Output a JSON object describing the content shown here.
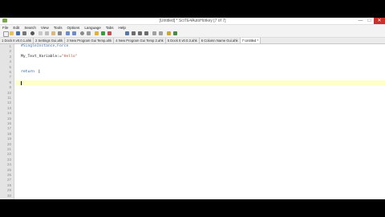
{
  "window": {
    "title": "[Untitled] * SciTE4AutoHotkey [7 of 7]",
    "controls": [
      "—",
      "□",
      "✕"
    ]
  },
  "menu": [
    "File",
    "Edit",
    "Search",
    "View",
    "Tools",
    "Options",
    "Language",
    "Tabs",
    "Help"
  ],
  "tabs": [
    {
      "label": "1 Dock It v0.0.1.ahk",
      "active": false
    },
    {
      "label": "2 Settings Gui.ahk",
      "active": false
    },
    {
      "label": "3 New Program Gui Temp.ahk",
      "active": false
    },
    {
      "label": "4 New Program Gui Temp 2.ahk",
      "active": false
    },
    {
      "label": "5 Dock It v0.0.3.ahk",
      "active": false
    },
    {
      "label": "6 Column Name Gui.ahk",
      "active": false
    },
    {
      "label": "7 Untitled *",
      "active": true
    }
  ],
  "editor": {
    "line_numbers": [
      "1",
      "2",
      "3",
      "4",
      "5",
      "6",
      "7",
      "8",
      "9",
      "10",
      "11",
      "12",
      "13",
      "14",
      "15",
      "16",
      "17",
      "18",
      "19",
      "20",
      "21",
      "22",
      "23",
      "24",
      "25",
      "26",
      "27",
      "28",
      "29",
      "30"
    ],
    "lines": {
      "l1": "#SingleInstance,Force",
      "l3_var": "My_Text_Variable:=",
      "l3_str": "\"Hello\"",
      "l6": "return"
    },
    "current_line": 8
  },
  "colors": {
    "directive": "#3a6fbf",
    "string": "#b8553a",
    "keyword": "#1d54a8",
    "current_line_highlight": "#ffffc8"
  }
}
